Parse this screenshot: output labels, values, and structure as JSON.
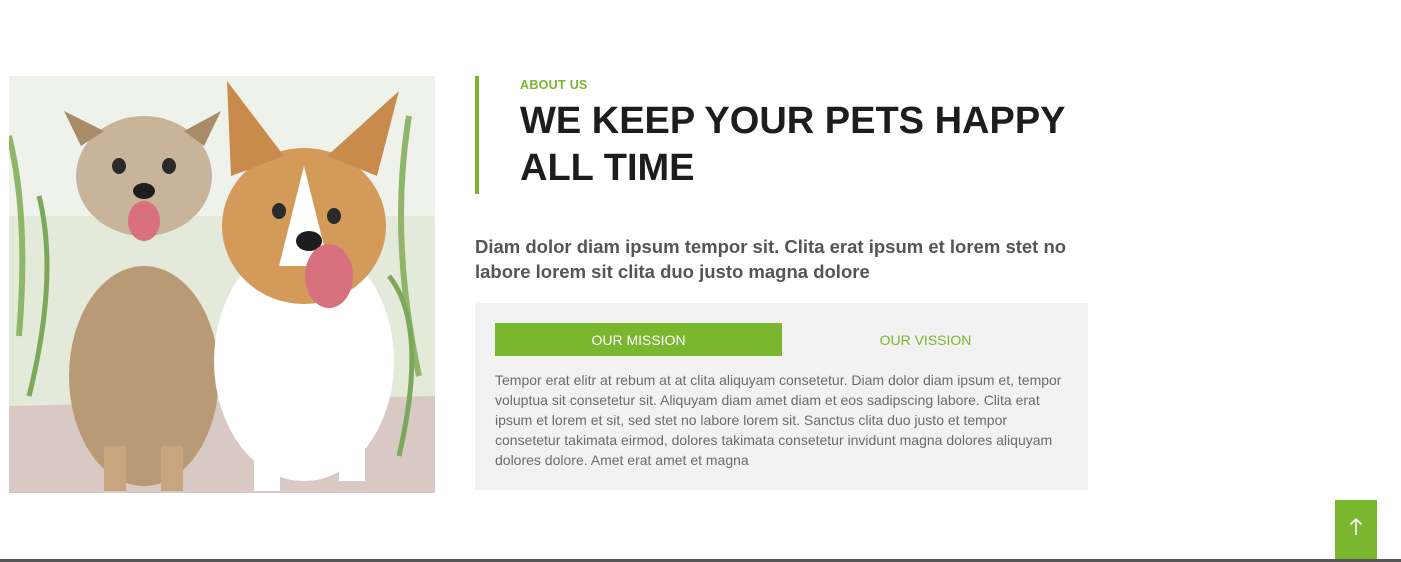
{
  "about": {
    "eyebrow": "ABOUT US",
    "headline": "WE KEEP YOUR PETS HAPPY ALL TIME",
    "lead": "Diam dolor diam ipsum tempor sit. Clita erat ipsum et lorem stet no labore lorem sit clita duo justo magna dolore"
  },
  "tabs": [
    {
      "label": "OUR MISSION",
      "active": true
    },
    {
      "label": "OUR VISSION",
      "active": false
    }
  ],
  "tab_content": "Tempor erat elitr at rebum at at clita aliquyam consetetur. Diam dolor diam ipsum et, tempor voluptua sit consetetur sit. Aliquyam diam amet diam et eos sadipscing labore. Clita erat ipsum et lorem et sit, sed stet no labore lorem sit. Sanctus clita duo justo et tempor consetetur takimata eirmod, dolores takimata consetetur invidunt magna dolores aliquyam dolores dolore. Amet erat amet et magna",
  "image": {
    "subject": "two-dogs-running-photo"
  },
  "back_to_top": {
    "icon": "arrow-up-icon"
  },
  "colors": {
    "accent": "#7ab62e",
    "heading": "#1d1d1d",
    "body_text": "#6b6b6b",
    "panel_bg": "#f2f2f2"
  }
}
